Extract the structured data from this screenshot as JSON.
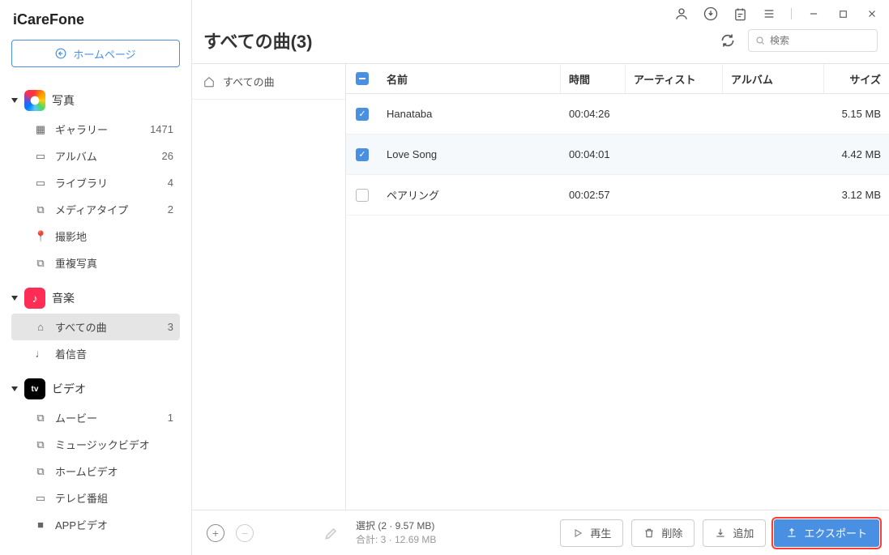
{
  "app_title": "iCareFone",
  "home_button": "ホームページ",
  "sidebar": {
    "groups": [
      {
        "label": "写真",
        "icon": "photos",
        "items": [
          {
            "icon": "gallery",
            "label": "ギャラリー",
            "count": "1471"
          },
          {
            "icon": "album",
            "label": "アルバム",
            "count": "26"
          },
          {
            "icon": "library",
            "label": "ライブラリ",
            "count": "4"
          },
          {
            "icon": "mediatype",
            "label": "メディアタイプ",
            "count": "2"
          },
          {
            "icon": "location",
            "label": "撮影地",
            "count": ""
          },
          {
            "icon": "duplicate",
            "label": "重複写真",
            "count": ""
          }
        ]
      },
      {
        "label": "音楽",
        "icon": "music",
        "items": [
          {
            "icon": "allsongs",
            "label": "すべての曲",
            "count": "3",
            "active": true
          },
          {
            "icon": "ringtone",
            "label": "着信音",
            "count": ""
          }
        ]
      },
      {
        "label": "ビデオ",
        "icon": "video",
        "items": [
          {
            "icon": "movie",
            "label": "ムービー",
            "count": "1"
          },
          {
            "icon": "musicvideo",
            "label": "ミュージックビデオ",
            "count": ""
          },
          {
            "icon": "homevideo",
            "label": "ホームビデオ",
            "count": ""
          },
          {
            "icon": "tvshow",
            "label": "テレビ番組",
            "count": ""
          },
          {
            "icon": "appvideo",
            "label": "APPビデオ",
            "count": ""
          }
        ]
      }
    ]
  },
  "page_title": "すべての曲(3)",
  "search_placeholder": "検索",
  "category_panel": {
    "all_songs": "すべての曲"
  },
  "table": {
    "headers": {
      "name": "名前",
      "time": "時間",
      "artist": "アーティスト",
      "album": "アルバム",
      "size": "サイズ"
    },
    "rows": [
      {
        "checked": true,
        "name": "Hanataba",
        "time": "00:04:26",
        "artist": "",
        "album": "",
        "size": "5.15 MB"
      },
      {
        "checked": true,
        "name": "Love Song",
        "time": "00:04:01",
        "artist": "",
        "album": "",
        "size": "4.42 MB"
      },
      {
        "checked": false,
        "name": "ペアリング",
        "time": "00:02:57",
        "artist": "",
        "album": "",
        "size": "3.12 MB"
      }
    ]
  },
  "footer": {
    "selection": "選択 (2 · 9.57 MB)",
    "total": "合計: 3 · 12.69 MB",
    "play": "再生",
    "delete": "削除",
    "add": "追加",
    "export": "エクスポート"
  }
}
